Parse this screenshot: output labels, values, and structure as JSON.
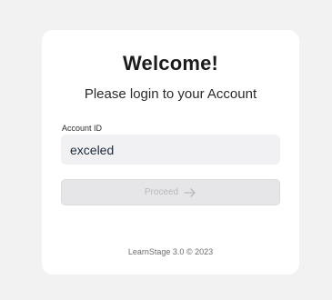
{
  "login": {
    "title": "Welcome!",
    "subtitle": "Please login to your Account",
    "account_id_label": "Account ID",
    "account_id_value": "exceled",
    "proceed_label": "Proceed",
    "proceed_icon": "arrow-right-icon",
    "footer": "LearnStage 3.0 © 2023"
  },
  "colors": {
    "background": "#f2f2f3",
    "card": "#ffffff",
    "input_bg": "#f1f1f3",
    "button_disabled_bg": "#e6e6e8",
    "button_disabled_text": "#b9b9bd"
  }
}
